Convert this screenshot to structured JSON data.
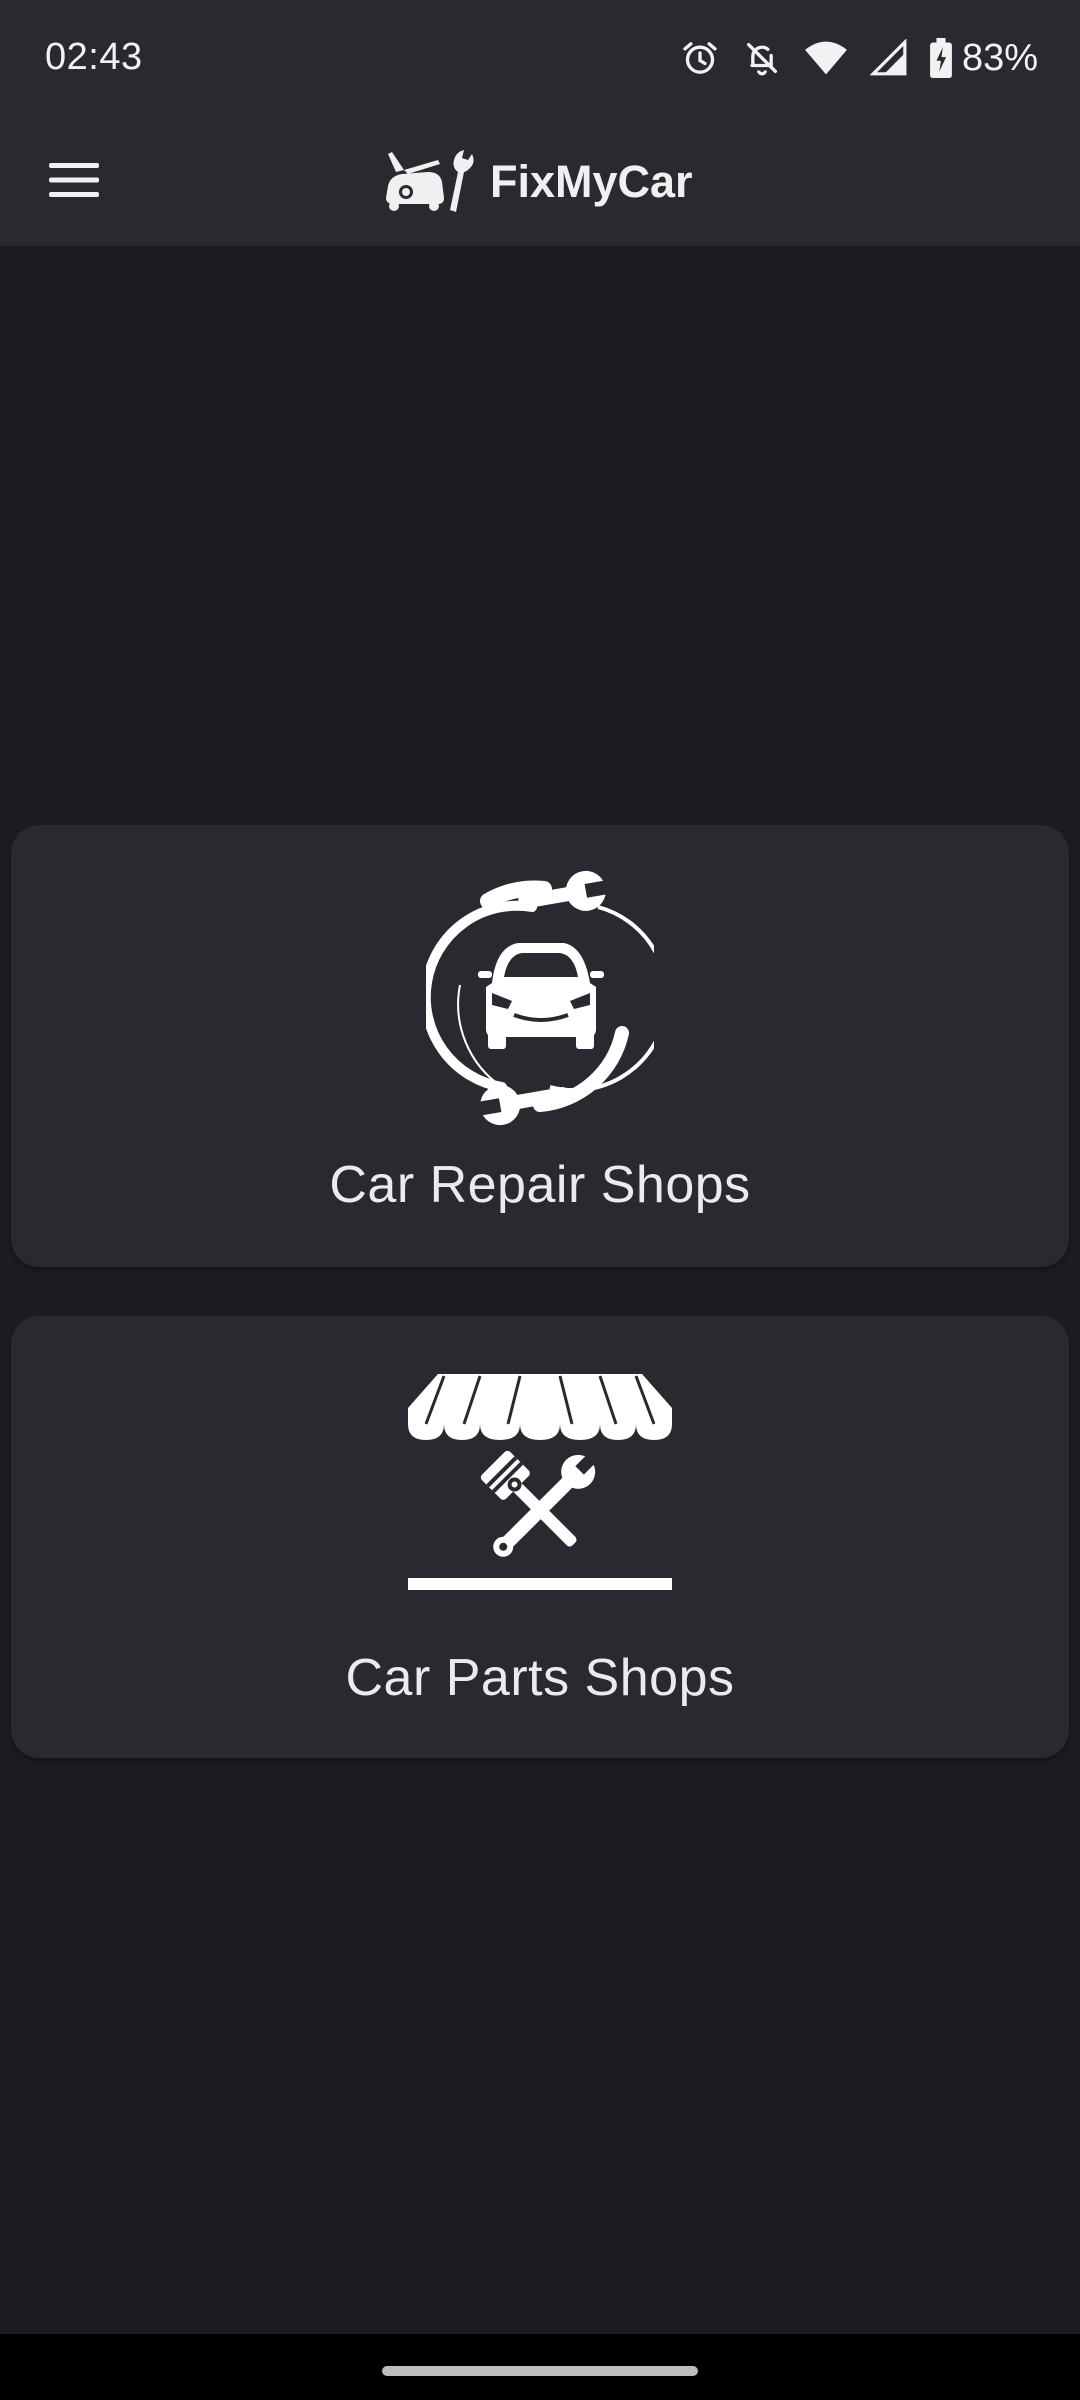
{
  "status_bar": {
    "time": "02:43",
    "battery_percent": "83%",
    "icons": [
      "alarm-icon",
      "notifications-off-icon",
      "wifi-icon",
      "cell-signal-icon",
      "battery-charging-icon"
    ]
  },
  "app_bar": {
    "title": "FixMyCar",
    "menu_icon": "hamburger-menu-icon",
    "logo_icon": "car-wrench-logo-icon"
  },
  "cards": {
    "repair": {
      "label": "Car Repair Shops",
      "icon": "car-repair-icon"
    },
    "parts": {
      "label": "Car Parts Shops",
      "icon": "car-parts-shop-icon"
    }
  },
  "colors": {
    "app_bar_bg": "#2b2930",
    "background": "#1d1c21",
    "card_bg": "#2b2930",
    "text": "#eceaf0"
  }
}
